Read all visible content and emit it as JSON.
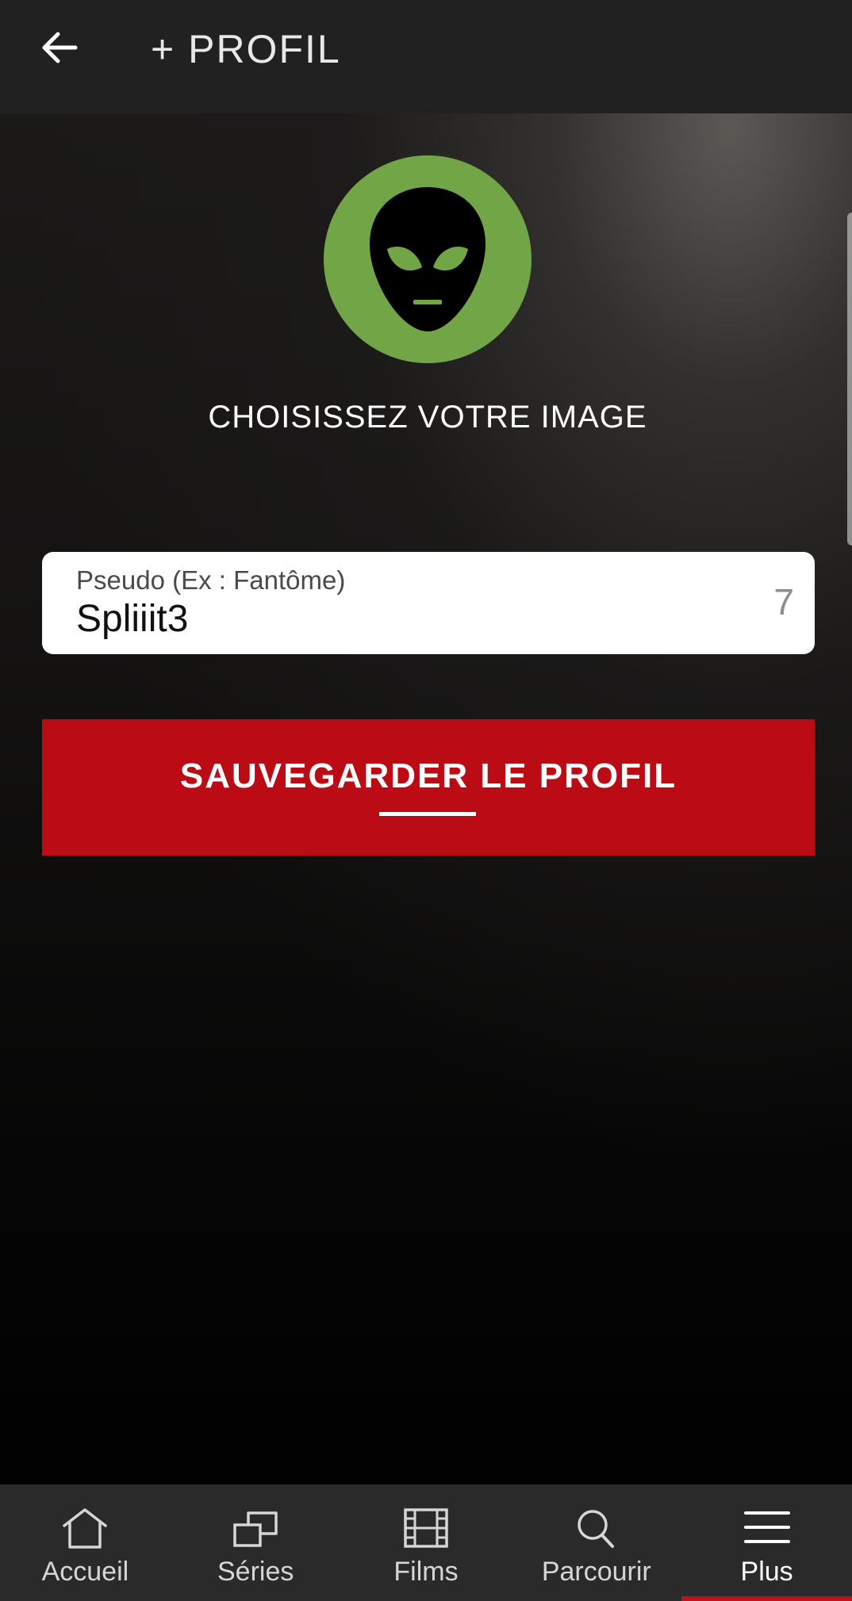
{
  "header": {
    "title": "+ PROFIL",
    "back_icon": "arrow-left-icon"
  },
  "avatar": {
    "icon": "alien-icon",
    "background_color": "#72a545",
    "choose_label": "CHOISISSEZ VOTRE IMAGE"
  },
  "form": {
    "pseudo_label": "Pseudo (Ex : Fantôme)",
    "pseudo_value": "Spliiit3",
    "char_count": "7"
  },
  "save_button": {
    "label": "SAUVEGARDER LE PROFIL",
    "color": "#bb0b14"
  },
  "bottom_nav": {
    "items": [
      {
        "label": "Accueil",
        "icon": "home-icon"
      },
      {
        "label": "Séries",
        "icon": "series-icon"
      },
      {
        "label": "Films",
        "icon": "film-icon"
      },
      {
        "label": "Parcourir",
        "icon": "search-icon"
      },
      {
        "label": "Plus",
        "icon": "menu-icon"
      }
    ],
    "active": "Plus",
    "active_color": "#c3101a"
  }
}
